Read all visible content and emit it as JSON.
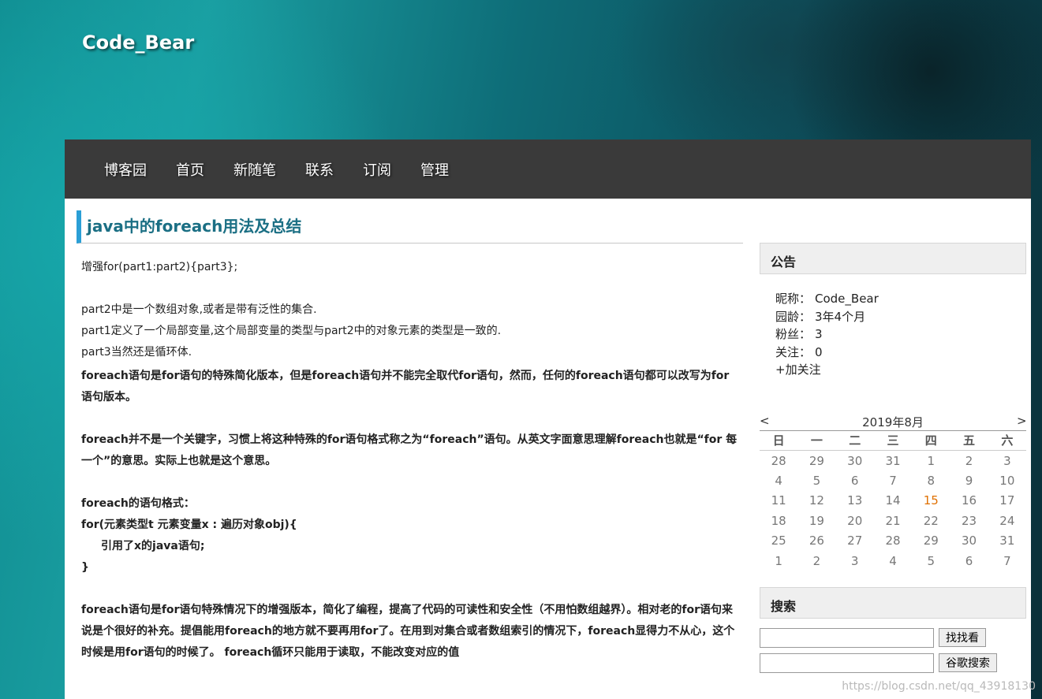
{
  "site": {
    "title": "Code_Bear"
  },
  "nav": [
    {
      "label": "博客园"
    },
    {
      "label": "首页"
    },
    {
      "label": "新随笔"
    },
    {
      "label": "联系"
    },
    {
      "label": "订阅"
    },
    {
      "label": "管理"
    }
  ],
  "post": {
    "title": "java中的foreach用法及总结",
    "line1": "增强for(part1:part2){part3};",
    "line2": "part2中是一个数组对象,或者是带有泛性的集合.",
    "line3": "part1定义了一个局部变量,这个局部变量的类型与part2中的对象元素的类型是一致的.",
    "line4": "part3当然还是循环体.",
    "para1": "foreach语句是for语句的特殊简化版本，但是foreach语句并不能完全取代for语句，然而，任何的foreach语句都可以改写为for语句版本。",
    "para2": "foreach并不是一个关键字，习惯上将这种特殊的for语句格式称之为“foreach”语句。从英文字面意思理解foreach也就是“for 每一个”的意思。实际上也就是这个意思。",
    "fmt_head": "foreach的语句格式：",
    "fmt1": "for(元素类型t 元素变量x : 遍历对象obj){",
    "fmt2": "引用了x的java语句;",
    "fmt3": "}",
    "para3": "foreach语句是for语句特殊情况下的增强版本，简化了编程，提高了代码的可读性和安全性（不用怕数组越界）。相对老的for语句来说是个很好的补充。提倡能用foreach的地方就不要再用for了。在用到对集合或者数组索引的情况下，foreach显得力不从心，这个时候是用for语句的时候了。 foreach循环只能用于读取，不能改变对应的值"
  },
  "notice": {
    "heading": "公告",
    "nick_label": "昵称：",
    "nick": "Code_Bear",
    "age_label": "园龄：",
    "age": "3年4个月",
    "fans_label": "粉丝：",
    "fans": "3",
    "follow_label": "关注：",
    "follow": "0",
    "add_follow": "+加关注"
  },
  "calendar": {
    "prev": "<",
    "month": "2019年8月",
    "next": ">",
    "weekdays": [
      "日",
      "一",
      "二",
      "三",
      "四",
      "五",
      "六"
    ],
    "weeks": [
      [
        "28",
        "29",
        "30",
        "31",
        "1",
        "2",
        "3"
      ],
      [
        "4",
        "5",
        "6",
        "7",
        "8",
        "9",
        "10"
      ],
      [
        "11",
        "12",
        "13",
        "14",
        "15",
        "16",
        "17"
      ],
      [
        "18",
        "19",
        "20",
        "21",
        "22",
        "23",
        "24"
      ],
      [
        "25",
        "26",
        "27",
        "28",
        "29",
        "30",
        "31"
      ],
      [
        "1",
        "2",
        "3",
        "4",
        "5",
        "6",
        "7"
      ]
    ],
    "today": "15"
  },
  "search": {
    "heading": "搜索",
    "btn1": "找找看",
    "btn2": "谷歌搜索"
  },
  "watermark": "https://blog.csdn.net/qq_43918130"
}
